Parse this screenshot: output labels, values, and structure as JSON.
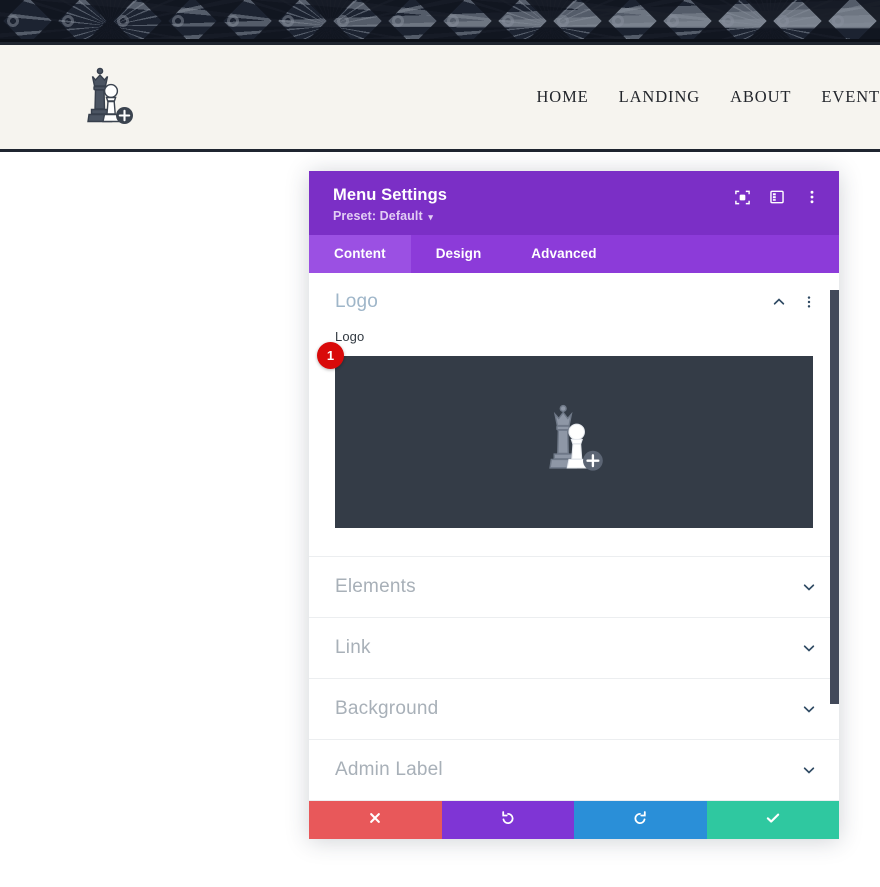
{
  "site": {
    "logo_icon": "chess-queen-pawn-logo",
    "nav": [
      {
        "label": "HOME"
      },
      {
        "label": "LANDING"
      },
      {
        "label": "ABOUT"
      },
      {
        "label": "EVENT"
      }
    ],
    "header_bg": "#f6f4ef",
    "header_border": "#1f2530",
    "pattern_bg": "#1c2331"
  },
  "modal": {
    "title": "Menu Settings",
    "preset_label": "Preset: Default",
    "preset_caret": "▾",
    "header_bg": "#7b2fc6",
    "header_icons": [
      {
        "name": "focus-target-icon"
      },
      {
        "name": "layout-panel-icon"
      },
      {
        "name": "more-vertical-icon"
      }
    ],
    "tabs": [
      {
        "label": "Content",
        "active": true
      },
      {
        "label": "Design",
        "active": false
      },
      {
        "label": "Advanced",
        "active": false
      }
    ],
    "tab_bg": "#8c3bd9",
    "tab_active_bg": "#9b50e3",
    "open_section": {
      "title": "Logo",
      "collapse_icon": "chevron-up-icon",
      "menu_icon": "more-vertical-icon",
      "field_label": "Logo",
      "upload_bg": "#343c47",
      "upload_icon": "chess-queen-pawn-add-image",
      "badge": "1",
      "badge_color": "#d90a0a"
    },
    "collapsed_sections": [
      {
        "label": "Elements",
        "icon": "chevron-down-icon"
      },
      {
        "label": "Link",
        "icon": "chevron-down-icon"
      },
      {
        "label": "Background",
        "icon": "chevron-down-icon"
      },
      {
        "label": "Admin Label",
        "icon": "chevron-down-icon"
      }
    ],
    "footer": [
      {
        "name": "close-button",
        "icon": "x-icon",
        "color": "#e8585a"
      },
      {
        "name": "undo-button",
        "icon": "undo-icon",
        "color": "#7f35d5"
      },
      {
        "name": "redo-button",
        "icon": "redo-icon",
        "color": "#2a8fd8"
      },
      {
        "name": "save-button",
        "icon": "checkmark-icon",
        "color": "#2fc8a0"
      }
    ],
    "scrollbar_color": "#42495a"
  }
}
